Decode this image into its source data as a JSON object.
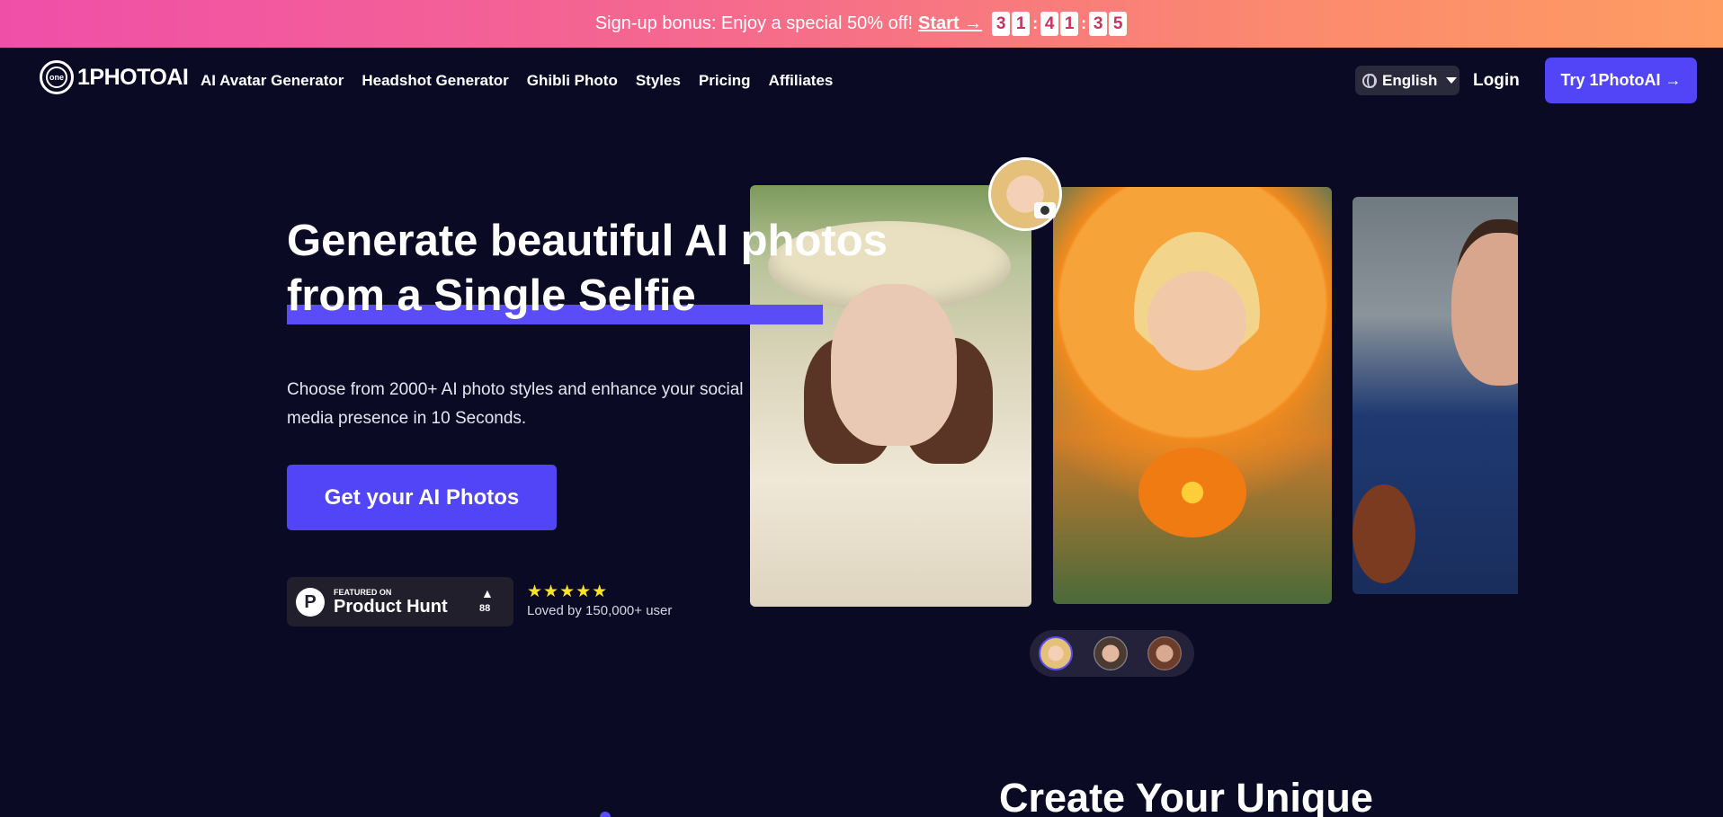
{
  "promo": {
    "text": "Sign-up bonus: Enjoy a special 50% off!",
    "link": "Start →",
    "countdown": [
      "3",
      "1",
      "4",
      "1",
      "3",
      "5"
    ]
  },
  "nav": {
    "logo_badge": "one",
    "logo_text": "1PHOTOAI",
    "links": [
      "AI Avatar Generator",
      "Headshot Generator",
      "Ghibli Photo",
      "Styles",
      "Pricing",
      "Affiliates"
    ],
    "language": "English",
    "login": "Login",
    "cta": "Try 1PhotoAI →"
  },
  "hero": {
    "title_line1": "Generate beautiful AI photos",
    "title_line2": "from a Single Selfie",
    "subtitle": "Choose from 2000+ AI photo styles and enhance your social media presence in 10 Seconds.",
    "cta": "Get your AI Photos",
    "product_hunt": {
      "featured": "FEATURED ON",
      "name": "Product Hunt",
      "logo": "P",
      "upvote": "▲",
      "votes": "88"
    },
    "rating": {
      "stars": "★★★★★",
      "text": "Loved by 150,000+ user"
    }
  },
  "section2": {
    "title": "Create Your Unique"
  },
  "colors": {
    "accent": "#5244f7",
    "background": "#0b0a24",
    "promo_start": "#f04fa8",
    "promo_end": "#fe9c62",
    "star": "#f7e32a"
  }
}
